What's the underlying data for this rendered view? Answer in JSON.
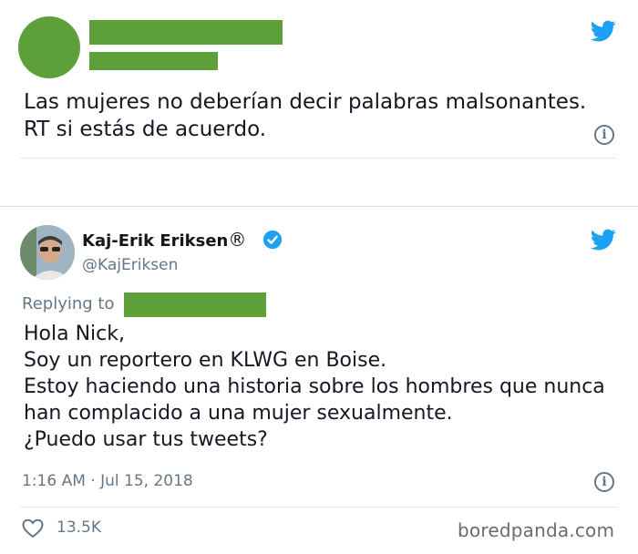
{
  "tweet1": {
    "text": "Las mujeres no deberían decir palabras malsonantes.\nRT si estás de acuerdo.",
    "info_icon": "i"
  },
  "tweet2": {
    "display_name": "Kaj-Erik Eriksen",
    "registered_mark": "®",
    "handle": "@KajEriksen",
    "replying_label": "Replying to",
    "text": "Hola Nick,\nSoy un reportero en KLWG en Boise.\nEstoy haciendo una historia sobre los hombres que nunca han complacido a una mujer sexualmente.\n¿Puedo usar tus tweets?",
    "timestamp": "1:16 AM · Jul 15, 2018",
    "likes": "13.5K",
    "info_icon": "i"
  },
  "watermark": "boredpanda.com",
  "colors": {
    "redaction_green": "#5da03a",
    "twitter_blue": "#1da1f2",
    "meta_gray": "#657786"
  },
  "icons": [
    "twitter-bird-icon",
    "info-icon",
    "verified-badge-icon",
    "heart-icon"
  ]
}
